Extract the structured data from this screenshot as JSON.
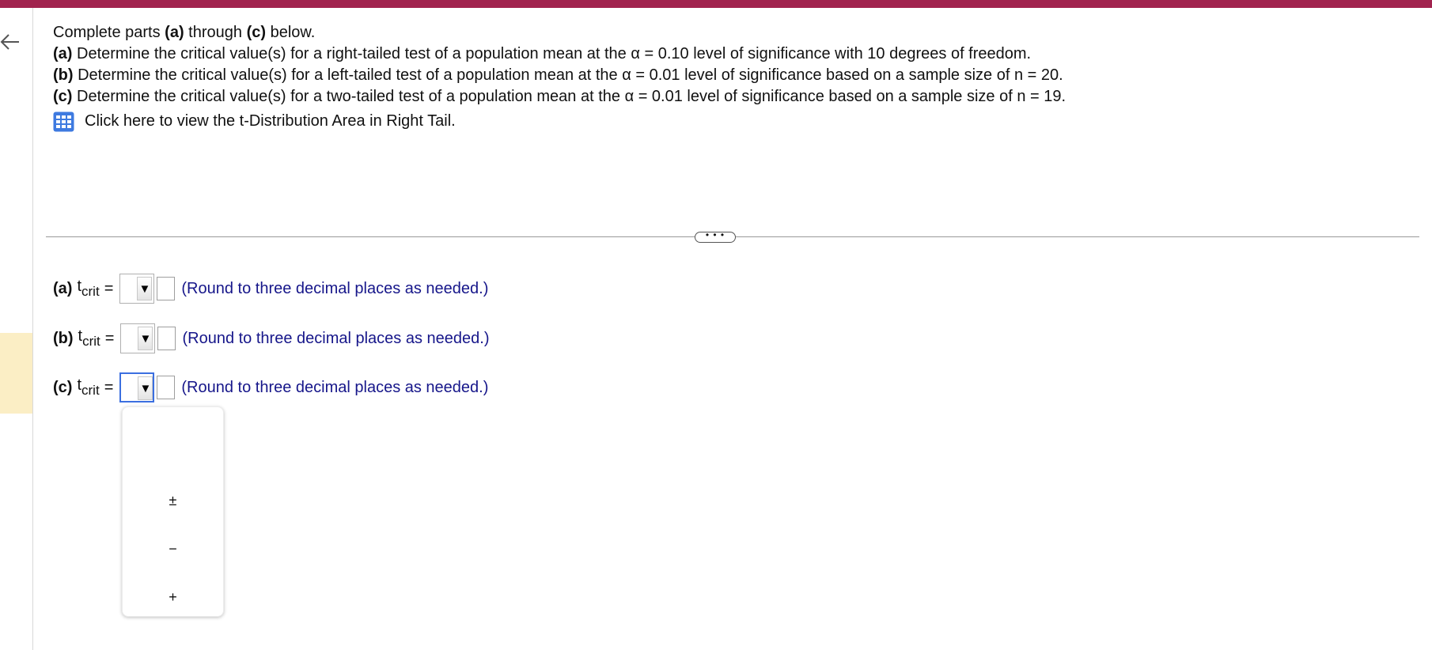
{
  "question": {
    "intro": [
      "Complete parts ",
      "(a)",
      " through ",
      "(c)",
      " below."
    ],
    "parts": [
      {
        "label": "(a)",
        "text": " Determine the critical value(s) for a right-tailed test of a population mean at the α = 0.10 level of significance with 10 degrees of freedom."
      },
      {
        "label": "(b)",
        "text": " Determine the critical value(s) for a left-tailed test of a population mean at the α = 0.01 level  of significance based on a sample size of n = 20."
      },
      {
        "label": "(c)",
        "text": " Determine the critical value(s) for a two-tailed test of a population mean at the α = 0.01 level of significance based on a sample size of n = 19."
      }
    ],
    "table_link": "Click here to view the t-Distribution Area in Right Tail."
  },
  "more_button": "• • •",
  "answers": [
    {
      "label": "(a)",
      "t": "t",
      "sub": "crit",
      "eq": "=",
      "hint": "(Round to three decimal places as needed.)"
    },
    {
      "label": "(b)",
      "t": "t",
      "sub": "crit",
      "eq": "=",
      "hint": "(Round to three decimal places as needed.)"
    },
    {
      "label": "(c)",
      "t": "t",
      "sub": "crit",
      "eq": "=",
      "hint": "(Round to three decimal places as needed.)"
    }
  ],
  "dropdown_arrow": "▼",
  "sign_options": [
    "±",
    "−",
    "+"
  ],
  "colors": {
    "brand": "#a1234e",
    "hint": "#16168a",
    "focus": "#3b6fe0",
    "highlight": "#fbeec5"
  }
}
